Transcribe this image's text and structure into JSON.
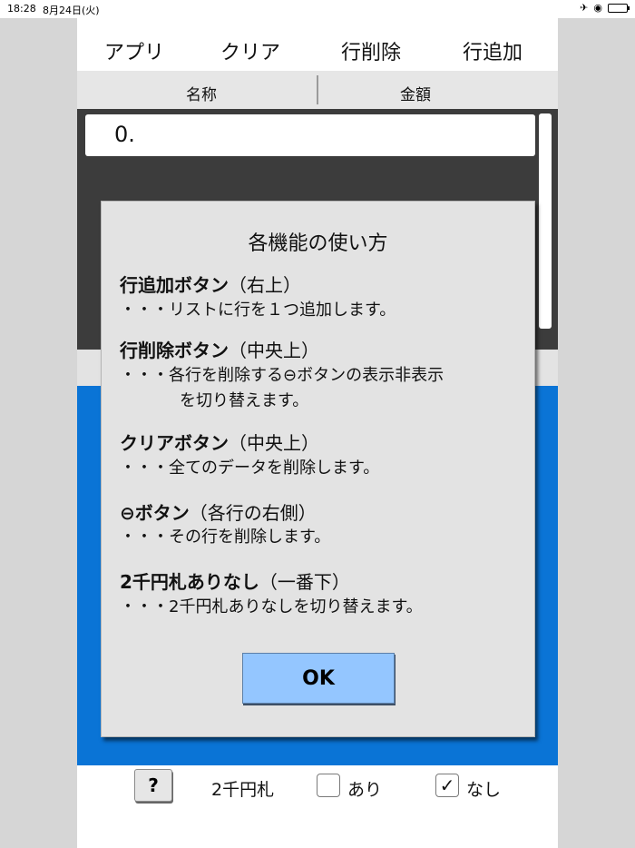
{
  "status_bar": {
    "time": "18:28",
    "date": "8月24日(火)",
    "icons": [
      "airplane-icon",
      "orientation-lock-icon",
      "battery-icon"
    ]
  },
  "toolbar": {
    "app_label": "アプリ",
    "clear_label": "クリア",
    "delete_row_label": "行削除",
    "add_row_label": "行追加"
  },
  "columns": {
    "name": "名称",
    "amount": "金額"
  },
  "list": {
    "rows": [
      {
        "value": "0."
      }
    ]
  },
  "footer": {
    "help_label": "?",
    "bill_label": "2千円札",
    "option_yes_label": "あり",
    "option_yes_checked": false,
    "option_no_label": "なし",
    "option_no_checked": true
  },
  "modal": {
    "title": "各機能の使い方",
    "sections": [
      {
        "title": "行追加ボタン",
        "note": "（右上）",
        "lines": [
          "・・・リストに行を１つ追加します。"
        ]
      },
      {
        "title": "行削除ボタン",
        "note": "（中央上）",
        "lines": [
          "・・・各行を削除する⊖ボタンの表示非表示",
          "を切り替えます。"
        ]
      },
      {
        "title": "クリアボタン",
        "note": "（中央上）",
        "lines": [
          "・・・全てのデータを削除します。"
        ]
      },
      {
        "title": "⊖ボタン",
        "note": "（各行の右側）",
        "lines": [
          "・・・その行を削除します。"
        ]
      },
      {
        "title": "2千円札ありなし",
        "note": "（一番下）",
        "lines": [
          "・・・2千円札ありなしを切り替えます。"
        ]
      }
    ],
    "ok_label": "OK"
  },
  "colors": {
    "blue_panel": "#0a74d6",
    "ok_button": "#94c6ff",
    "list_background": "#3c3c3c",
    "modal_background": "#e3e3e3"
  }
}
